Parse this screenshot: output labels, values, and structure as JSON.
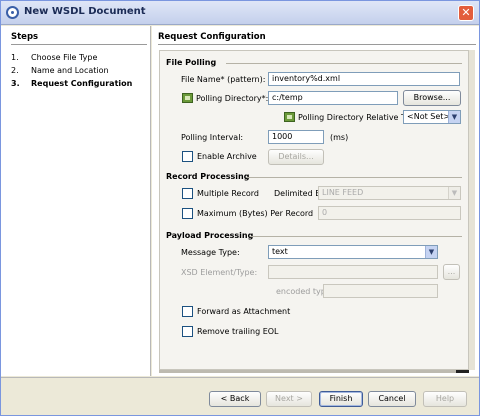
{
  "window": {
    "title": "New WSDL Document"
  },
  "steps": {
    "title": "Steps",
    "items": [
      {
        "num": "1.",
        "label": "Choose File Type"
      },
      {
        "num": "2.",
        "label": "Name and Location"
      },
      {
        "num": "3.",
        "label": "Request Configuration"
      }
    ]
  },
  "panel": {
    "title": "Request Configuration",
    "file_polling": {
      "heading": "File Polling",
      "file_name_label": "File Name* (pattern):",
      "file_name_value": "inventory%d.xml",
      "polling_dir_label": "Polling Directory*:",
      "polling_dir_value": "c:/temp",
      "browse_label": "Browse...",
      "relative_label": "Polling Directory Relative To:",
      "relative_value": "<Not Set>",
      "interval_label": "Polling Interval:",
      "interval_value": "1000",
      "interval_unit": "(ms)",
      "archive_label": "Enable Archive",
      "details_label": "Details..."
    },
    "record_processing": {
      "heading": "Record Processing",
      "multiple_label": "Multiple Record",
      "delimited_label": "Delimited By:",
      "delimited_value": "LINE FEED",
      "max_label": "Maximum (Bytes) Per Record",
      "max_value": "0"
    },
    "payload_processing": {
      "heading": "Payload Processing",
      "message_type_label": "Message Type:",
      "message_type_value": "text",
      "xsd_label": "XSD Element/Type:",
      "xsd_value": "",
      "xsd_button": "...",
      "encoded_label": "encoded type:",
      "encoded_value": "",
      "forward_label": "Forward as Attachment",
      "remove_eol_label": "Remove trailing EOL"
    }
  },
  "buttons": {
    "back": "< Back",
    "next": "Next >",
    "finish": "Finish",
    "cancel": "Cancel",
    "help": "Help"
  }
}
